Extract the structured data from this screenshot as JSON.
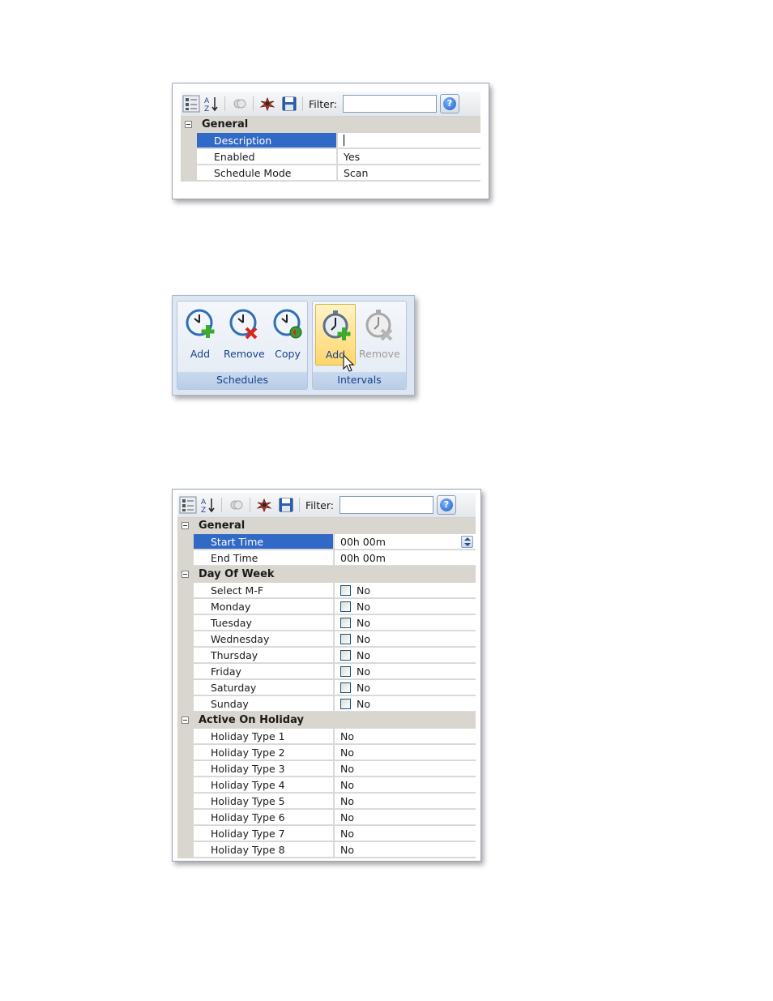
{
  "panel1": {
    "toolbar": {
      "filter_label": "Filter:",
      "filter_value": "",
      "help": "?"
    },
    "categories": [
      {
        "label": "General",
        "rows": [
          {
            "name": "Description",
            "value": ""
          },
          {
            "name": "Enabled",
            "value": "Yes"
          },
          {
            "name": "Schedule Mode",
            "value": "Scan"
          }
        ]
      }
    ]
  },
  "ribbon": {
    "groups": [
      {
        "label": "Schedules",
        "buttons": [
          {
            "label": "Add",
            "icon": "clock-add-icon"
          },
          {
            "label": "Remove",
            "icon": "clock-remove-icon"
          },
          {
            "label": "Copy",
            "icon": "clock-copy-icon"
          }
        ]
      },
      {
        "label": "Intervals",
        "buttons": [
          {
            "label": "Add",
            "icon": "stopwatch-add-icon"
          },
          {
            "label": "Remove",
            "icon": "stopwatch-remove-icon"
          }
        ]
      }
    ]
  },
  "panel2": {
    "toolbar": {
      "filter_label": "Filter:",
      "filter_value": "",
      "help": "?"
    },
    "categories": [
      {
        "label": "General",
        "rows": [
          {
            "name": "Start Time",
            "value": "00h 00m"
          },
          {
            "name": "End Time",
            "value": "00h 00m"
          }
        ]
      },
      {
        "label": "Day Of Week",
        "rows": [
          {
            "name": "Select M-F",
            "value": "No"
          },
          {
            "name": "Monday",
            "value": "No"
          },
          {
            "name": "Tuesday",
            "value": "No"
          },
          {
            "name": "Wednesday",
            "value": "No"
          },
          {
            "name": "Thursday",
            "value": "No"
          },
          {
            "name": "Friday",
            "value": "No"
          },
          {
            "name": "Saturday",
            "value": "No"
          },
          {
            "name": "Sunday",
            "value": "No"
          }
        ]
      },
      {
        "label": "Active On Holiday",
        "rows": [
          {
            "name": "Holiday Type 1",
            "value": "No"
          },
          {
            "name": "Holiday Type 2",
            "value": "No"
          },
          {
            "name": "Holiday Type 3",
            "value": "No"
          },
          {
            "name": "Holiday Type 4",
            "value": "No"
          },
          {
            "name": "Holiday Type 5",
            "value": "No"
          },
          {
            "name": "Holiday Type 6",
            "value": "No"
          },
          {
            "name": "Holiday Type 7",
            "value": "No"
          },
          {
            "name": "Holiday Type 8",
            "value": "No"
          }
        ]
      }
    ]
  }
}
